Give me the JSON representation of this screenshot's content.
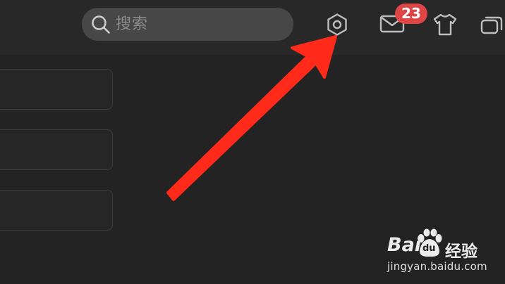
{
  "search": {
    "placeholder": "搜索",
    "icon": "search-icon"
  },
  "toolbar": {
    "settings_icon": "gear-icon",
    "mail_icon": "mail-icon",
    "mail_badge_count": "23",
    "skin_icon": "tshirt-icon",
    "windows_icon": "windows-icon"
  },
  "list": {
    "items": [
      {
        "label": ""
      },
      {
        "label": ""
      },
      {
        "label": ""
      }
    ]
  },
  "annotation": {
    "arrow_color": "#ff2a1a",
    "arrow_target": "settings"
  },
  "watermark": {
    "brand_prefix": "Bai",
    "brand_paw_text": "du",
    "brand_suffix": "经验",
    "url": "jingyan.baidu.com"
  },
  "colors": {
    "background": "#232323",
    "topbar": "#282828",
    "search_bg": "#474747",
    "badge": "#e04545"
  }
}
